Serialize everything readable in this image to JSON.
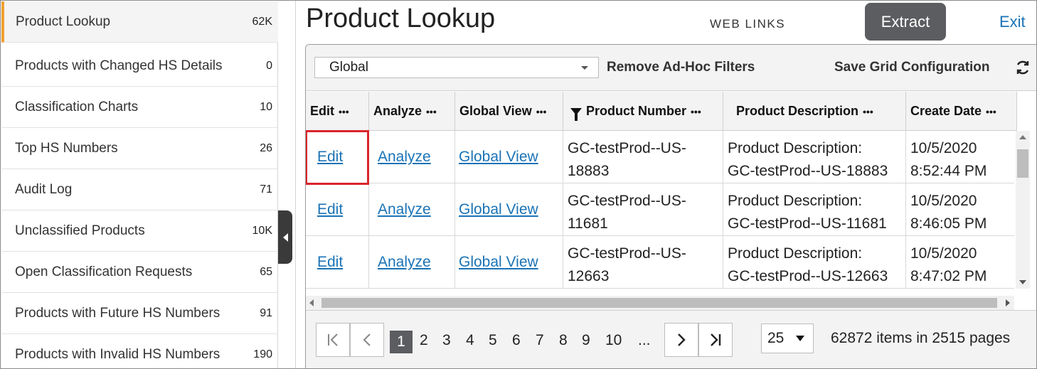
{
  "sidebar": {
    "items": [
      {
        "label": "Product Lookup",
        "count": "62K"
      },
      {
        "label": "Products with Changed HS Details",
        "count": "0"
      },
      {
        "label": "Classification Charts",
        "count": "10"
      },
      {
        "label": "Top HS Numbers",
        "count": "26"
      },
      {
        "label": "Audit Log",
        "count": "71"
      },
      {
        "label": "Unclassified Products",
        "count": "10K"
      },
      {
        "label": "Open Classification Requests",
        "count": "65"
      },
      {
        "label": "Products with Future HS Numbers",
        "count": "91"
      },
      {
        "label": "Products with Invalid HS Numbers",
        "count": "190"
      }
    ]
  },
  "header": {
    "title": "Product Lookup",
    "web_links": "WEB LINKS",
    "extract": "Extract",
    "exit": "Exit"
  },
  "toolbar": {
    "selected_view": "Global",
    "remove_filters": "Remove Ad-Hoc Filters",
    "save_config": "Save Grid Configuration"
  },
  "table": {
    "columns": [
      "Edit",
      "Analyze",
      "Global View",
      "Product Number",
      "Product Description",
      "Create Date"
    ],
    "column_menu": "•••",
    "rows": [
      {
        "edit": "Edit",
        "analyze": "Analyze",
        "global": "Global View",
        "number_l1": "GC-testProd--US-",
        "number_l2": "18883",
        "desc_l1": "Product Description:",
        "desc_l2": "GC-testProd--US-18883",
        "date_l1": "10/5/2020",
        "date_l2": "8:52:44 PM"
      },
      {
        "edit": "Edit",
        "analyze": "Analyze",
        "global": "Global View",
        "number_l1": "GC-testProd--US-",
        "number_l2": "11681",
        "desc_l1": "Product Description:",
        "desc_l2": "GC-testProd--US-11681",
        "date_l1": "10/5/2020",
        "date_l2": "8:46:05 PM"
      },
      {
        "edit": "Edit",
        "analyze": "Analyze",
        "global": "Global View",
        "number_l1": "GC-testProd--US-",
        "number_l2": "12663",
        "desc_l1": "Product Description:",
        "desc_l2": "GC-testProd--US-12663",
        "date_l1": "10/5/2020",
        "date_l2": "8:47:02 PM"
      }
    ]
  },
  "pager": {
    "pages": [
      "1",
      "2",
      "3",
      "4",
      "5",
      "6",
      "7",
      "8",
      "9",
      "10",
      "..."
    ],
    "page_size": "25",
    "items_info": "62872 items  in 2515 pages"
  },
  "colors": {
    "accent": "#f0a030",
    "link": "#1a73b6",
    "highlight": "#d9242b",
    "button": "#5b5d60"
  }
}
